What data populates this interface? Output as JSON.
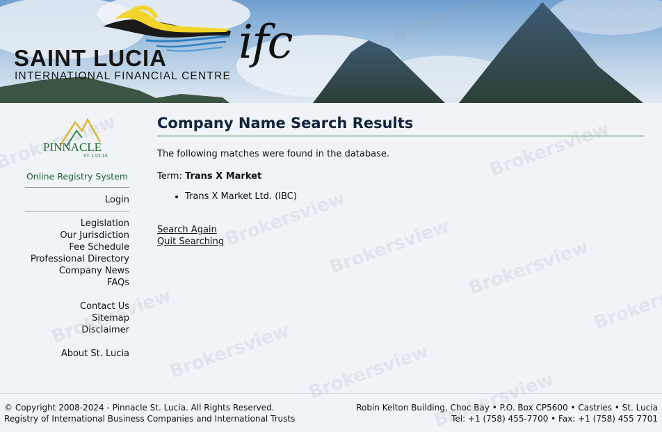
{
  "header": {
    "title": "SAINT LUCIA",
    "subtitle": "INTERNATIONAL FINANCIAL CENTRE",
    "ifc_logo": "ifc"
  },
  "sidebar": {
    "logo_name": "PINNACLE",
    "logo_sub": "ST. LUCIA",
    "system_label": "Online Registry System",
    "login": "Login",
    "nav": [
      "Legislation",
      "Our Jurisdiction",
      "Fee Schedule",
      "Professional Directory",
      "Company News",
      "FAQs"
    ],
    "nav2": [
      "Contact Us",
      "Sitemap",
      "Disclaimer"
    ],
    "about": "About St. Lucia"
  },
  "main": {
    "title": "Company Name Search Results",
    "intro": "The following matches were found in the database.",
    "term_label": "Term:",
    "term_value": "Trans X Market",
    "results": [
      "Trans X Market Ltd. (IBC)"
    ],
    "search_again": "Search Again",
    "quit_searching": "Quit Searching"
  },
  "footer": {
    "left_line1": "© Copyright 2008-2024 - Pinnacle St. Lucia. All Rights Reserved.",
    "left_line2": "Registry of International Business Companies and International Trusts",
    "right_line1": "Robin Kelton Building, Choc Bay • P.O. Box CP5600 • Castries • St. Lucia",
    "right_line2": "Tel: +1 (758) 455-7700 • Fax: +1 (758) 455 7701"
  },
  "watermark": "Brokersview",
  "colors": {
    "accent_green": "#2a7a35",
    "title_navy": "#13233a",
    "background": "#f0f3f8"
  }
}
